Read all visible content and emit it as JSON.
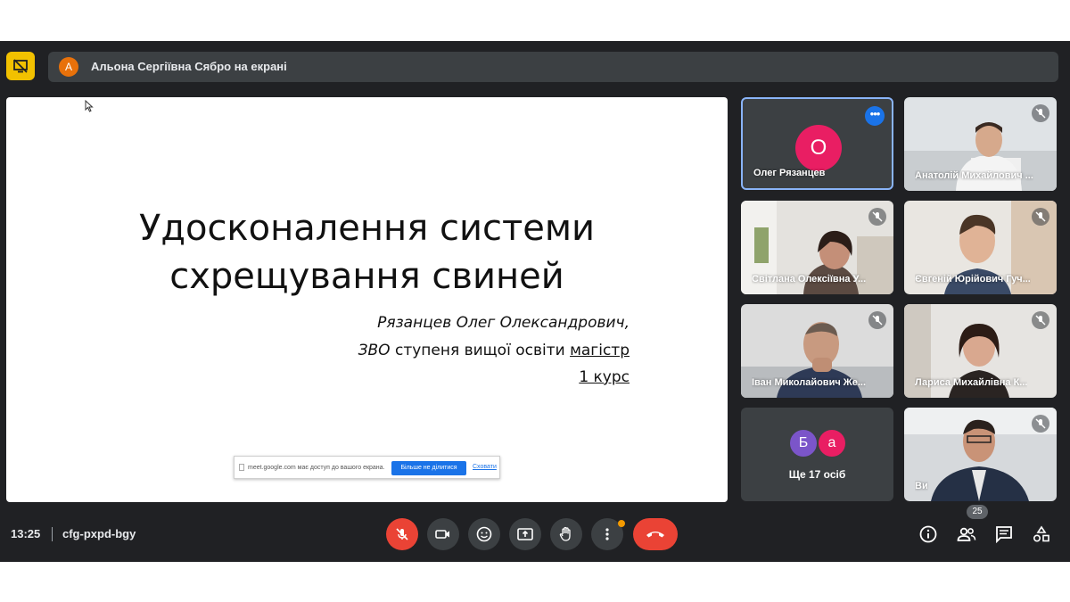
{
  "presenter": {
    "avatar_letter": "А",
    "text": "Альона Сергіївна Сябро на екрані"
  },
  "slide": {
    "title_line1": "Удосконалення системи",
    "title_line2": "схрещування свиней",
    "author": "Рязанцев Олег Олександрович,",
    "degree_prefix": "ЗВО",
    "degree_mid": " ступеня вищої освіти ",
    "degree_level": "магістр",
    "course": "1 курс"
  },
  "share_banner": {
    "text": "meet.google.com має доступ до вашого екрана.",
    "stop_label": "Більше не ділитися",
    "hide_label": "Сховати"
  },
  "participants": {
    "oleg": {
      "avatar_letter": "О",
      "name": "Олег Рязанцев",
      "avatar_color": "#e91e63"
    },
    "anatolii": {
      "name": "Анатолій Михайлович ..."
    },
    "svitlana": {
      "name": "Світлана Олексіївна У..."
    },
    "yevhenii": {
      "name": "Євгеній Юрійович Гуч..."
    },
    "ivan": {
      "name": "Іван Миколайович Же..."
    },
    "larysa": {
      "name": "Лариса Михайлівна К..."
    },
    "you": {
      "name": "Ви"
    },
    "more": {
      "avatar1": "Б",
      "avatar1_color": "#7b55c9",
      "avatar2": "а",
      "avatar2_color": "#e91e63",
      "label": "Ще 17 осіб"
    }
  },
  "bottom": {
    "time": "13:25",
    "meeting_code": "cfg-pxpd-bgy",
    "people_count": "25"
  },
  "colors": {
    "background": "#202124",
    "tile": "#3c4043",
    "accent": "#1a73e8",
    "danger": "#ea4335",
    "present": "#f2c100"
  }
}
